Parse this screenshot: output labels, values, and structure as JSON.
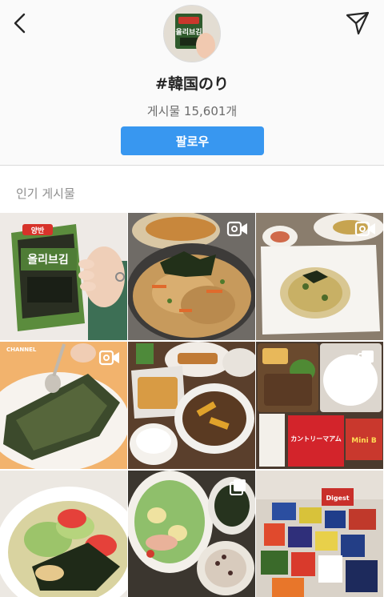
{
  "header": {
    "back_icon": "chevron-left-icon",
    "send_icon": "paper-plane-icon",
    "hashtag": "#韓国のり",
    "post_count": "게시물 15,601개",
    "follow_label": "팔로우",
    "profile_pack_label": "올리브김"
  },
  "top_posts": {
    "title": "인기 게시물"
  },
  "grid": {
    "tiles": [
      {
        "name": "post-seaweed-pack",
        "type": "photo",
        "pack_brand": "양반",
        "pack_label": "올리브김"
      },
      {
        "name": "post-fried-rice-seaweed",
        "type": "video"
      },
      {
        "name": "post-rice-omelet-plate",
        "type": "video"
      },
      {
        "name": "post-seaweed-spoon",
        "type": "video",
        "watermark": "CHANNEL"
      },
      {
        "name": "post-dinner-table",
        "type": "photo"
      },
      {
        "name": "post-bento-snacks",
        "type": "carousel",
        "snack_label_1": "カントリーマアム",
        "snack_label_2": "Mini B"
      },
      {
        "name": "post-salad-bowl",
        "type": "photo"
      },
      {
        "name": "post-meal-set",
        "type": "carousel"
      },
      {
        "name": "post-snack-haul",
        "type": "photo",
        "snack_label": "Digest"
      }
    ]
  },
  "colors": {
    "accent": "#3897f0",
    "background": "#fafafa",
    "divider": "#dbdbdb"
  }
}
